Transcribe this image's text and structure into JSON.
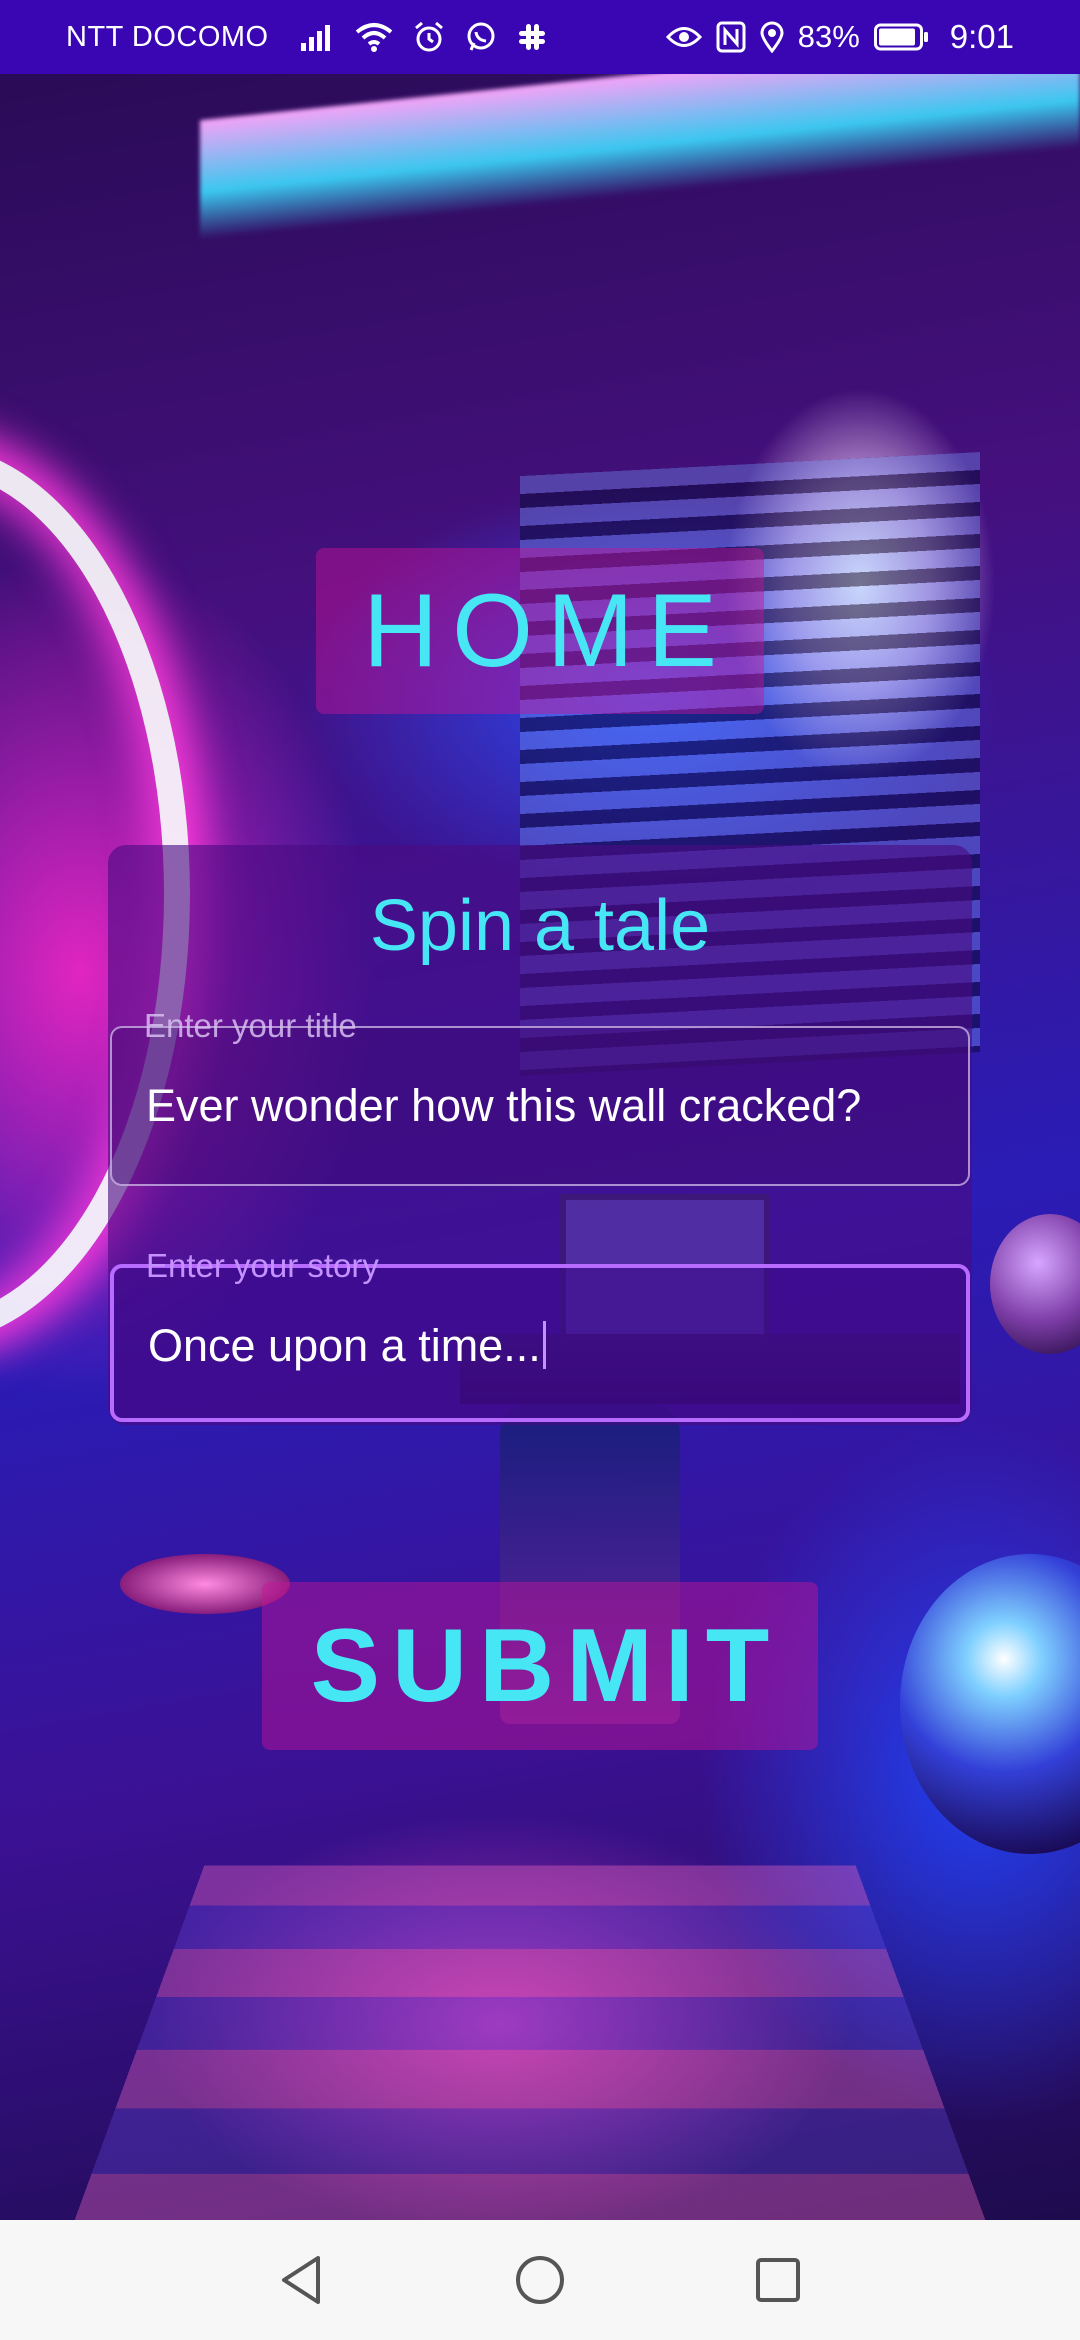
{
  "status_bar": {
    "carrier": "NTT DOCOMO",
    "battery_percent": "83%",
    "time": "9:01",
    "icons_left": [
      "signal-icon",
      "wifi-icon",
      "alarm-icon",
      "whatsapp-icon",
      "slack-icon"
    ],
    "icons_right": [
      "eye-icon",
      "nfc-icon",
      "location-icon",
      "battery-icon"
    ]
  },
  "home_button": {
    "label": "HOME"
  },
  "story_form": {
    "heading": "Spin a tale",
    "title_field": {
      "label": "Enter your title",
      "value": "Ever wonder how this wall cracked?"
    },
    "story_field": {
      "label": "Enter your story",
      "value": "Once upon a time...",
      "focused": true
    }
  },
  "submit_button": {
    "label": "SUBMIT"
  },
  "colors": {
    "status_bar_bg": "#3a06b4",
    "accent_cyan": "#47e6f5",
    "button_bg": "rgba(200,20,150,0.45)",
    "focus_outline": "#b86cff",
    "nav_bar_bg": "#f7f7f7"
  },
  "nav_bar": {
    "buttons": [
      "back-icon",
      "home-circle-icon",
      "recents-square-icon"
    ]
  }
}
